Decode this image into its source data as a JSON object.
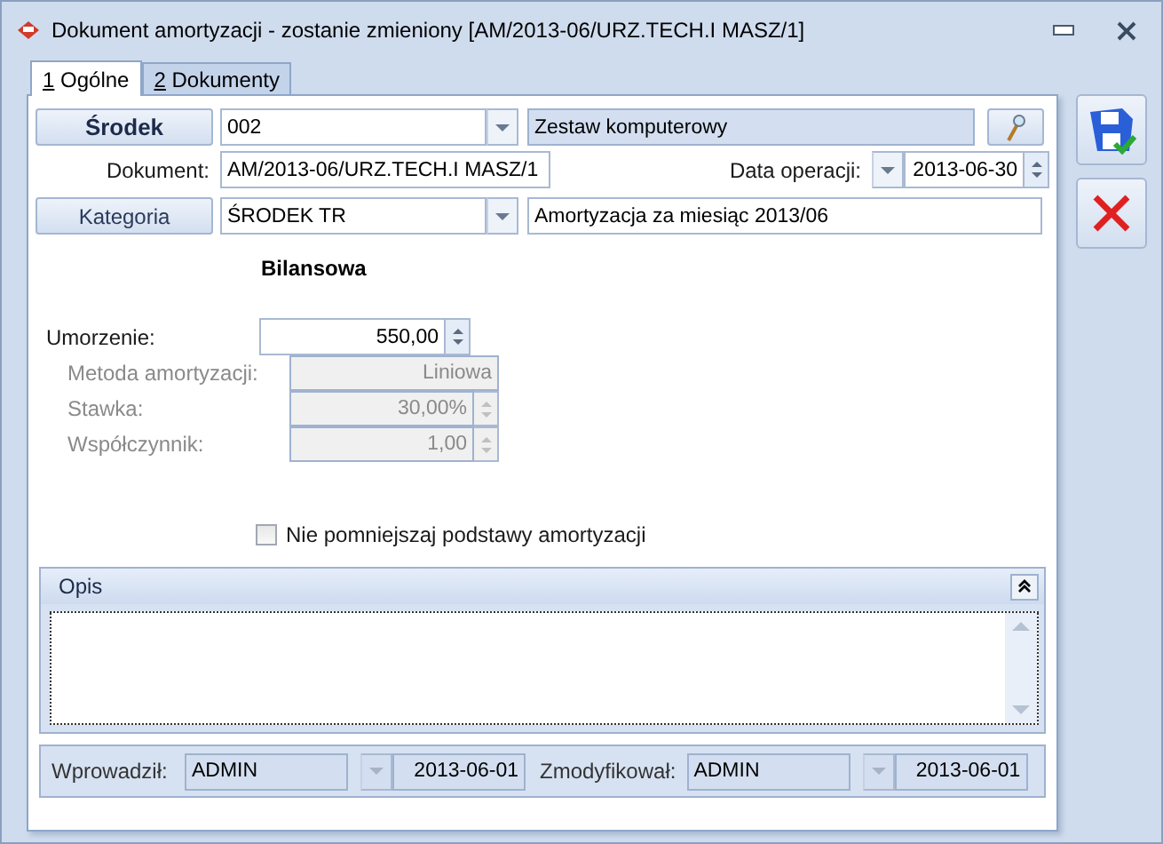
{
  "window": {
    "title": "Dokument amortyzacji - zostanie zmieniony [AM/2013-06/URZ.TECH.I MASZ/1]"
  },
  "tabs": [
    {
      "number": "1",
      "label": "Ogólne",
      "selected": true
    },
    {
      "number": "2",
      "label": "Dokumenty",
      "selected": false
    }
  ],
  "asset": {
    "button": "Środek",
    "code": "002",
    "name": "Zestaw komputerowy"
  },
  "document": {
    "label": "Dokument:",
    "value": "AM/2013-06/URZ.TECH.I MASZ/1",
    "date_label": "Data operacji:",
    "date": "2013-06-30"
  },
  "category": {
    "button": "Kategoria",
    "value": "ŚRODEK TR",
    "description": "Amortyzacja za miesiąc 2013/06"
  },
  "section_title": "Bilansowa",
  "amount": {
    "label": "Umorzenie:",
    "value": "550,00"
  },
  "method": {
    "label": "Metoda amortyzacji:",
    "value": "Liniowa",
    "disabled": true
  },
  "rate": {
    "label": "Stawka:",
    "value": "30,00%",
    "disabled": true
  },
  "factor": {
    "label": "Współczynnik:",
    "value": "1,00",
    "disabled": true
  },
  "checkbox": {
    "label": "Nie pomniejszaj podstawy amortyzacji",
    "checked": false
  },
  "description_panel": {
    "title": "Opis",
    "expanded": true
  },
  "footer": {
    "created_label": "Wprowadził:",
    "created_by": "ADMIN",
    "created_date": "2013-06-01",
    "modified_label": "Zmodyfikował:",
    "modified_by": "ADMIN",
    "modified_date": "2013-06-01"
  }
}
